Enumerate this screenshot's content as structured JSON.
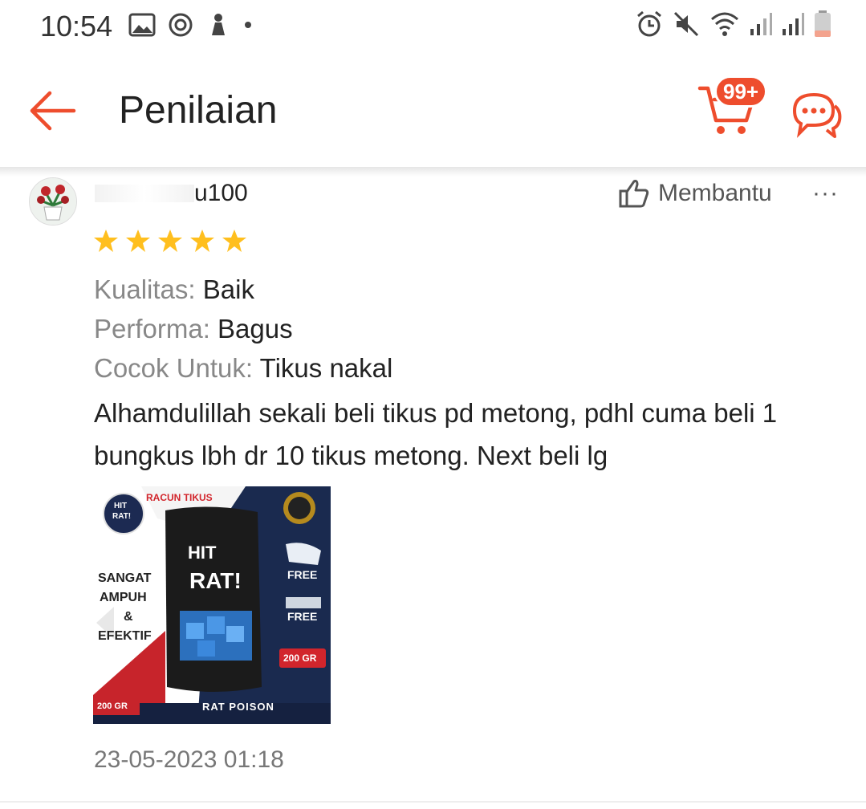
{
  "status_bar": {
    "time": "10:54",
    "left_icons": [
      "gallery-icon",
      "sync-icon",
      "notification-app-icon",
      "dot-icon"
    ],
    "right_icons": [
      "alarm-icon",
      "mute-icon",
      "wifi-icon",
      "signal-icon",
      "signal-icon",
      "battery-low-icon"
    ]
  },
  "header": {
    "title": "Penilaian",
    "cart_badge": "99+",
    "accent_color": "#ee4d2d"
  },
  "review": {
    "username": "u100",
    "helpful_label": "Membantu",
    "more_label": "···",
    "rating": 5,
    "attributes": [
      {
        "key": "Kualitas:",
        "value": "Baik"
      },
      {
        "key": "Performa:",
        "value": "Bagus"
      },
      {
        "key": "Cocok Untuk:",
        "value": "Tikus nakal"
      }
    ],
    "text": "Alhamdulillah sekali beli tikus pd metong, pdhl cuma beli 1 bungkus lbh dr 10 tikus metong. Next beli lg",
    "photo": {
      "top_label": "RACUN TIKUS",
      "logo_line1": "HIT",
      "logo_line2": "RAT!",
      "brand_line1": "HIT",
      "brand_line2": "RAT!",
      "side_text_1": "SANGAT",
      "side_text_2": "AMPUH",
      "side_text_3": "&",
      "side_text_4": "EFEKTIF",
      "free_1": "FREE",
      "free_2": "FREE",
      "weight_right": "200 GR",
      "weight_left": "200 GR",
      "footer": "RAT POISON"
    },
    "date": "23-05-2023 01:18"
  }
}
